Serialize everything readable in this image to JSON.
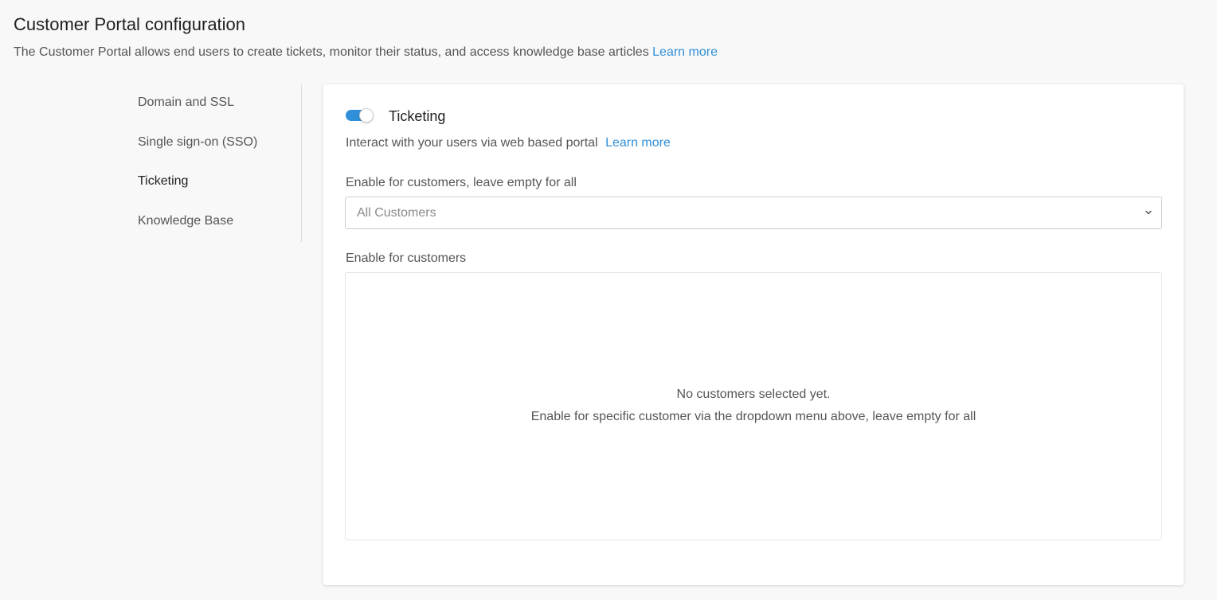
{
  "header": {
    "title": "Customer Portal configuration",
    "description": "The Customer Portal allows end users to create tickets, monitor their status, and access knowledge base articles",
    "learn_more": "Learn more"
  },
  "sidebar": {
    "items": [
      {
        "label": "Domain and SSL",
        "active": false
      },
      {
        "label": "Single sign-on (SSO)",
        "active": false
      },
      {
        "label": "Ticketing",
        "active": true
      },
      {
        "label": "Knowledge Base",
        "active": false
      }
    ]
  },
  "ticketing": {
    "toggle_enabled": true,
    "title": "Ticketing",
    "description": "Interact with your users via web based portal",
    "learn_more": "Learn more",
    "select_label": "Enable for customers, leave empty for all",
    "select_value": "All Customers",
    "list_label": "Enable for customers",
    "empty_title": "No customers selected yet.",
    "empty_subtitle": "Enable for specific customer via the dropdown menu above, leave empty for all"
  },
  "colors": {
    "accent": "#2f8fd8",
    "background": "#f8f8f8",
    "card": "#ffffff"
  }
}
